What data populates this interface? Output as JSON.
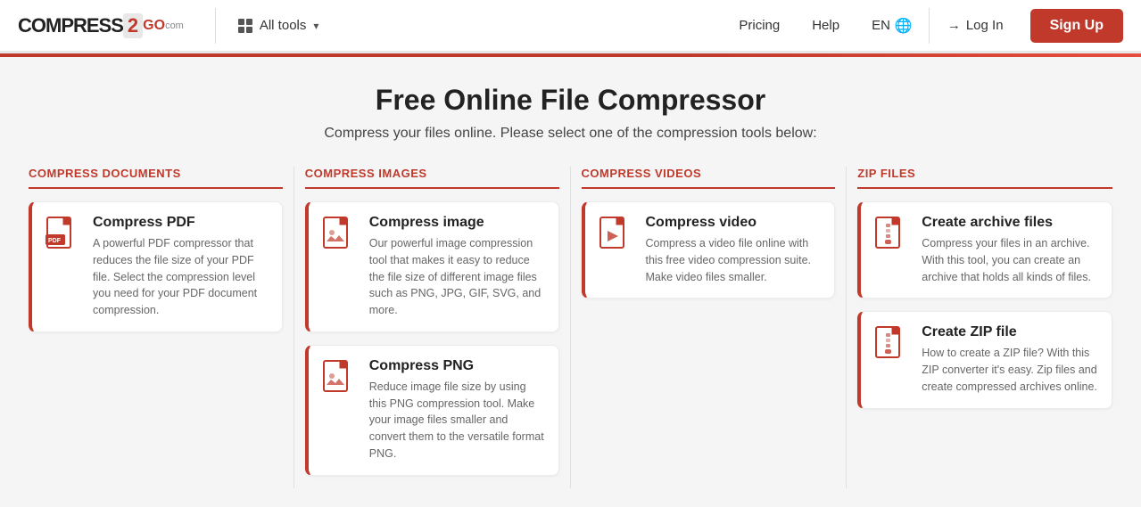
{
  "header": {
    "logo_compress": "COMPRESS",
    "logo_2": "2",
    "logo_go": "GO",
    "logo_com": "com",
    "all_tools_label": "All tools",
    "pricing_label": "Pricing",
    "help_label": "Help",
    "lang_label": "EN",
    "login_label": "Log In",
    "signup_label": "Sign Up"
  },
  "page": {
    "title": "Free Online File Compressor",
    "subtitle": "Compress your files online. Please select one of the compression tools below:"
  },
  "columns": [
    {
      "id": "compress-documents",
      "header": "COMPRESS DOCUMENTS",
      "cards": [
        {
          "id": "compress-pdf",
          "title": "Compress PDF",
          "desc": "A powerful PDF compressor that reduces the file size of your PDF file. Select the compression level you need for your PDF document compression.",
          "icon_type": "pdf"
        }
      ]
    },
    {
      "id": "compress-images",
      "header": "COMPRESS IMAGES",
      "cards": [
        {
          "id": "compress-image",
          "title": "Compress image",
          "desc": "Our powerful image compression tool that makes it easy to reduce the file size of different image files such as PNG, JPG, GIF, SVG, and more.",
          "icon_type": "image"
        },
        {
          "id": "compress-png",
          "title": "Compress PNG",
          "desc": "Reduce image file size by using this PNG compression tool. Make your image files smaller and convert them to the versatile format PNG.",
          "icon_type": "image"
        }
      ]
    },
    {
      "id": "compress-videos",
      "header": "COMPRESS VIDEOS",
      "cards": [
        {
          "id": "compress-video",
          "title": "Compress video",
          "desc": "Compress a video file online with this free video compression suite. Make video files smaller.",
          "icon_type": "video"
        }
      ]
    },
    {
      "id": "zip-files",
      "header": "ZIP FILES",
      "cards": [
        {
          "id": "create-archive",
          "title": "Create archive files",
          "desc": "Compress your files in an archive. With this tool, you can create an archive that holds all kinds of files.",
          "icon_type": "zip"
        },
        {
          "id": "create-zip",
          "title": "Create ZIP file",
          "desc": "How to create a ZIP file? With this ZIP converter it's easy. Zip files and create compressed archives online.",
          "icon_type": "zip"
        }
      ]
    }
  ],
  "icons": {
    "pdf": "pdf",
    "image": "image",
    "video": "video",
    "zip": "zip"
  }
}
